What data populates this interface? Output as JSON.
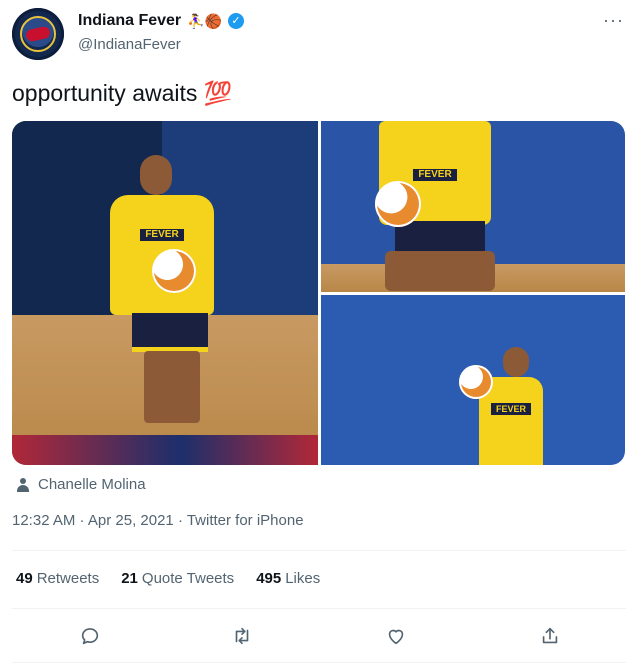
{
  "account": {
    "display_name": "Indiana Fever",
    "name_emojis": "⛹️‍♀️🏀",
    "handle": "@IndianaFever",
    "verified": true
  },
  "tweet": {
    "text": "opportunity awaits",
    "emoji": "💯"
  },
  "media": {
    "photo_count": 3,
    "jersey_text": "FEVER",
    "credit": "Chanelle Molina"
  },
  "meta": {
    "line": "12:32 AM · Apr 25, 2021 · Twitter for iPhone"
  },
  "stats": [
    {
      "count": "49",
      "label": "Retweets"
    },
    {
      "count": "21",
      "label": "Quote Tweets"
    },
    {
      "count": "495",
      "label": "Likes"
    }
  ],
  "actions": [
    "reply-icon",
    "retweet-icon",
    "like-icon",
    "share-icon"
  ],
  "colors": {
    "accent": "#1d9bf0",
    "text_primary": "#0f1419",
    "text_secondary": "#536471",
    "fever_yellow": "#f5d21c",
    "fever_navy": "#1a2140"
  }
}
